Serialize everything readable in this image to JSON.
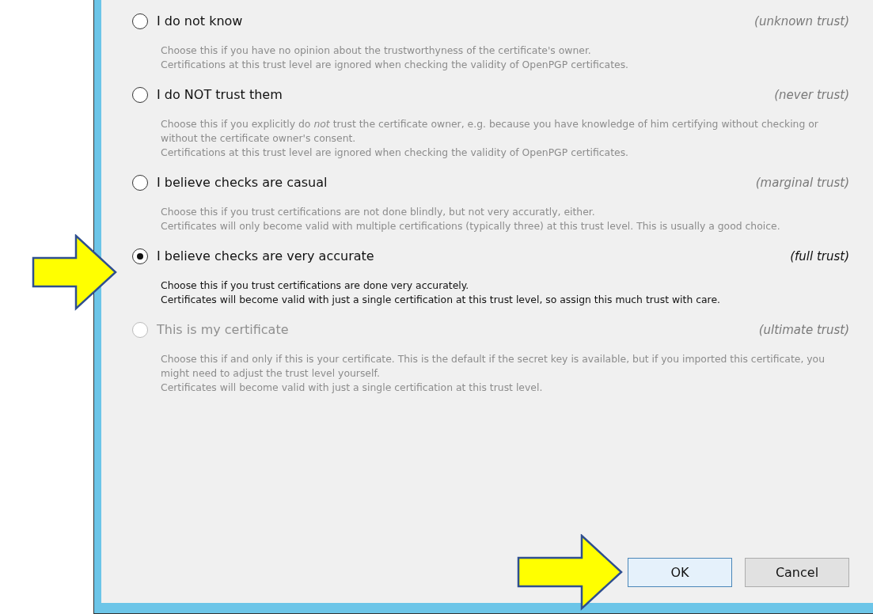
{
  "options": [
    {
      "label": "I do not know",
      "trust": "(unknown trust)",
      "selected": false,
      "disabled": false,
      "description": [
        "Choose this if you have no opinion about the trustworthyness of the certificate's owner.",
        "Certifications at this trust level are ignored when checking the validity of OpenPGP certificates."
      ]
    },
    {
      "label": "I do NOT trust them",
      "trust": "(never trust)",
      "selected": false,
      "disabled": false,
      "description": [
        "Choose this if you explicitly do *not* trust the certificate owner, e.g. because you have knowledge of him certifying without checking or without the certificate owner's consent.",
        "Certifications at this trust level are ignored when checking the validity of OpenPGP certificates."
      ]
    },
    {
      "label": "I believe checks are casual",
      "trust": "(marginal trust)",
      "selected": false,
      "disabled": false,
      "description": [
        "Choose this if you trust certifications are not done blindly, but not very accuratly, either.",
        "Certificates will only become valid with multiple certifications (typically three) at this trust level. This is usually a good choice."
      ]
    },
    {
      "label": "I believe checks are very accurate",
      "trust": "(full trust)",
      "selected": true,
      "disabled": false,
      "description": [
        "Choose this if you trust certifications are done very accurately.",
        "Certificates will become valid with just a single certification at this trust level, so assign this much trust with care."
      ]
    },
    {
      "label": "This is my certificate",
      "trust": "(ultimate trust)",
      "selected": false,
      "disabled": true,
      "description": [
        "Choose this if and only if this is your certificate. This is the default if the secret key is available, but if you imported this certificate, you might need to adjust the trust level yourself.",
        "Certificates will become valid with just a single certification at this trust level."
      ]
    }
  ],
  "buttons": [
    {
      "label": "OK",
      "default": true
    },
    {
      "label": "Cancel",
      "default": false
    }
  ]
}
